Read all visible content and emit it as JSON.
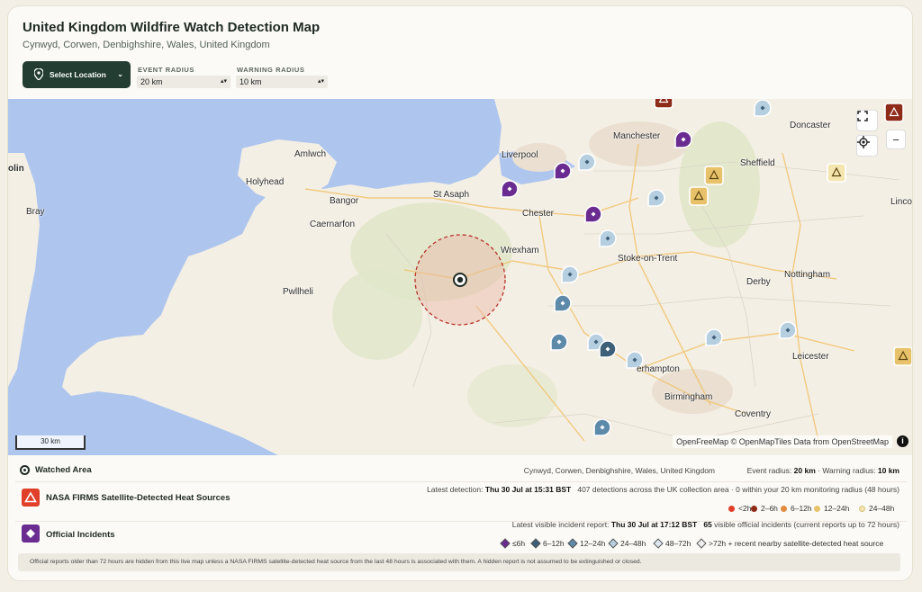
{
  "header": {
    "title": "United Kingdom Wildfire Watch Detection Map",
    "subtitle": "Cynwyd, Corwen, Denbighshire, Wales, United Kingdom"
  },
  "controls": {
    "select_location_label": "Select Location",
    "event_radius_label": "EVENT RADIUS",
    "event_radius_value": "20 km",
    "warning_radius_label": "WARNING RADIUS",
    "warning_radius_value": "10 km"
  },
  "map": {
    "cities": [
      "Amlwch",
      "Holyhead",
      "Bangor",
      "Caernarfon",
      "Pwllheli",
      "Bray",
      "olin",
      "St Asaph",
      "Liverpool",
      "Chester",
      "Wrexham",
      "Manchester",
      "Stoke-on-Trent",
      "Sheffield",
      "Doncaster",
      "Lincol",
      "Nottingham",
      "Derby",
      "Leicester",
      "Birmingham",
      "Coventry",
      "erhampton"
    ],
    "scale_label": "30 km",
    "attribution_osm": "OpenFreeMap © OpenMapTiles",
    "attribution_data": "Data from OpenStreetMap",
    "info_label": "i",
    "zoom_out_label": "−",
    "colors": {
      "sea": "#aec6ee",
      "land": "#f4efe4",
      "green": "#dfe6c9",
      "circle": "#c0392b"
    }
  },
  "legend": {
    "watched": {
      "label": "Watched Area",
      "location": "Cynwyd, Corwen, Denbighshire, Wales, United Kingdom",
      "event_radius_prefix": "Event radius: ",
      "event_radius": "20 km",
      "warning_radius_prefix": " · Warning radius: ",
      "warning_radius": "10 km"
    },
    "firms": {
      "label": "NASA FIRMS Satellite-Detected Heat Sources",
      "latest_prefix": "Latest detection: ",
      "latest": "Thu 30 Jul at 15:31 BST",
      "summary": "407 detections across the UK collection area · 0 within your 20 km monitoring radius (48 hours)",
      "ages": [
        {
          "label": "<2h",
          "color": "#e0402a"
        },
        {
          "label": "2–6h",
          "color": "#8e2a18"
        },
        {
          "label": "6–12h",
          "color": "#e28b3e"
        },
        {
          "label": "12–24h",
          "color": "#e8c26a"
        },
        {
          "label": "24–48h",
          "color": "#f5e6b0"
        }
      ]
    },
    "incidents": {
      "label": "Official Incidents",
      "latest_prefix": "Latest visible incident report: ",
      "latest": "Thu 30 Jul at 17:12 BST",
      "count": "65",
      "summary": " visible official incidents (current reports up to 72 hours)",
      "ages": [
        {
          "label": "≤6h",
          "color": "#6a2c91"
        },
        {
          "label": "6–12h",
          "color": "#3e5f78"
        },
        {
          "label": "12–24h",
          "color": "#5e8aaa"
        },
        {
          "label": "24–48h",
          "color": "#b6cfe0"
        },
        {
          "label": "48–72h",
          "color": "#dde8f0"
        },
        {
          "label": ">72h + recent nearby satellite-detected heat source",
          "color": "#eeeeee"
        }
      ]
    }
  },
  "footnote": "Official reports older than 72 hours are hidden from this live map unless a NASA FIRMS satellite-detected heat source from the last 48 hours is associated with them. A hidden report is not assumed to be extinguished or closed."
}
